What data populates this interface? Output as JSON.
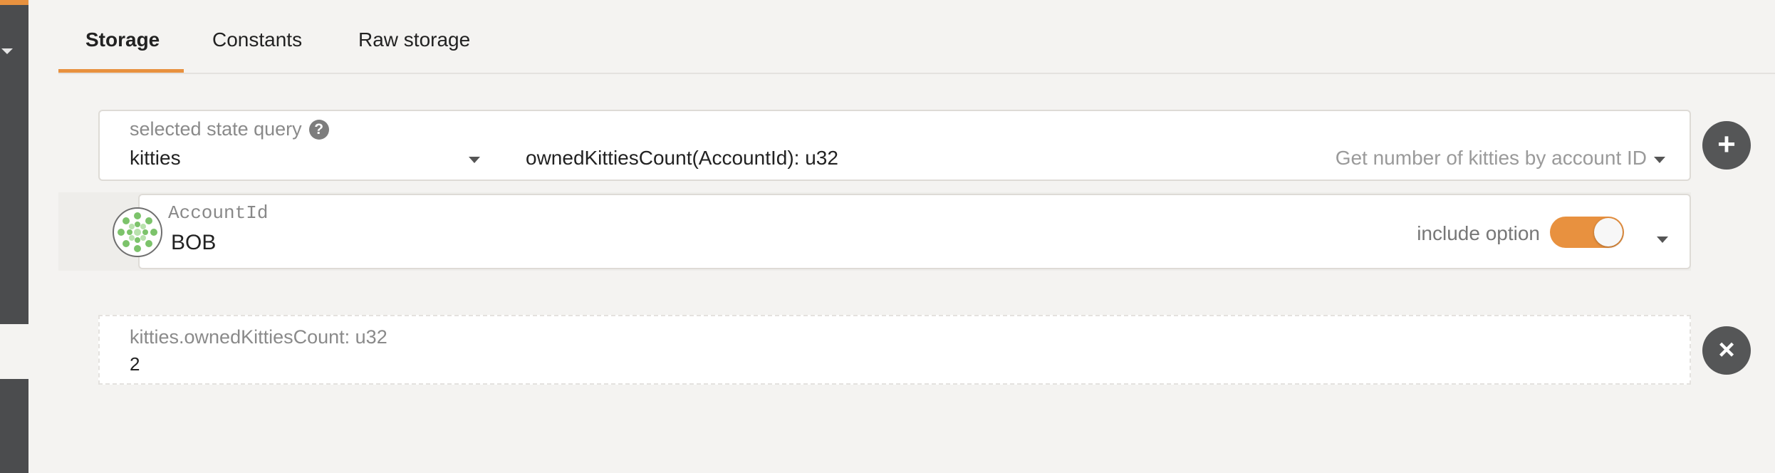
{
  "tabs": [
    {
      "label": "Storage",
      "active": true
    },
    {
      "label": "Constants",
      "active": false
    },
    {
      "label": "Raw storage",
      "active": false
    }
  ],
  "query": {
    "label": "selected state query",
    "module": "kitties",
    "method": "ownedKittiesCount(AccountId): u32",
    "description": "Get number of kitties by account ID"
  },
  "param": {
    "label": "AccountId",
    "value": "BOB",
    "include_option_label": "include option",
    "include_option_on": true
  },
  "result": {
    "label": "kitties.ownedKittiesCount: u32",
    "value": "2"
  },
  "buttons": {
    "add": "+",
    "remove": "×"
  },
  "colors": {
    "accent": "#e8913f",
    "sidebar": "#4b4c4e",
    "button": "#555657"
  }
}
